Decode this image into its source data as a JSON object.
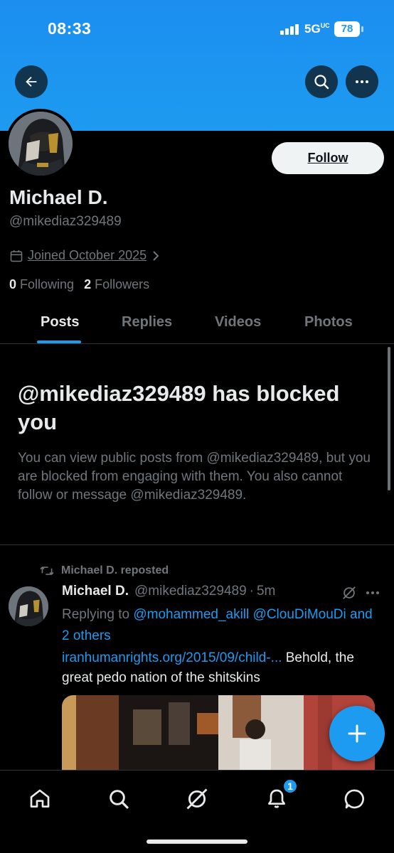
{
  "status_bar": {
    "time": "08:33",
    "network": "5G",
    "network_sup": "UC",
    "battery": "78"
  },
  "profile": {
    "name": "Michael D.",
    "handle": "@mikediaz329489",
    "joined": "Joined October 2025",
    "following_count": "0",
    "following_label": "Following",
    "followers_count": "2",
    "followers_label": "Followers",
    "follow_label": "Follow"
  },
  "tabs": [
    "Posts",
    "Replies",
    "Videos",
    "Photos"
  ],
  "active_tab": "Posts",
  "blocked": {
    "title": "@mikediaz329489 has blocked you",
    "description": "You can view public posts from @mikediaz329489, but you are blocked from engaging with them. You also cannot follow or message @mikediaz329489."
  },
  "post": {
    "repost_label": "Michael D. reposted",
    "author_name": "Michael D.",
    "author_handle": "@mikediaz329489",
    "separator": "·",
    "time": "5m",
    "replying_prefix": "Replying to",
    "replying_user1": "@mohammed_akill",
    "replying_user2": "@ClouDiMouDi",
    "replying_others": "and 2 others",
    "link": "iranhumanrights.org/2015/09/child-...",
    "text": "Behold, the great pedo nation of the shitskins"
  },
  "nav": {
    "notifications_badge": "1",
    "icons": [
      "home-icon",
      "search-icon",
      "grok-icon",
      "notifications-icon",
      "messages-icon"
    ]
  },
  "colors": {
    "accent": "#1d9bf0",
    "background": "#000000",
    "text_primary": "#e7e9ea",
    "text_secondary": "#71767b",
    "divider": "#2f3336"
  }
}
